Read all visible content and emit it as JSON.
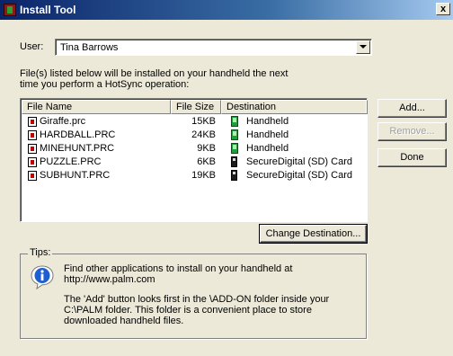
{
  "window": {
    "title": "Install Tool",
    "close_label": "x"
  },
  "user": {
    "label": "User:",
    "selected": "Tina Barrows"
  },
  "description": [
    "File(s) listed below will be installed on your handheld the next",
    "time you perform a HotSync operation:"
  ],
  "table": {
    "columns": [
      "File Name",
      "File Size",
      "Destination"
    ],
    "rows": [
      {
        "name": "Giraffe.prc",
        "size": "15KB",
        "destination": "Handheld",
        "dest_icon": "handheld-icon"
      },
      {
        "name": "HARDBALL.PRC",
        "size": "24KB",
        "destination": "Handheld",
        "dest_icon": "handheld-icon"
      },
      {
        "name": "MINEHUNT.PRC",
        "size": "9KB",
        "destination": "Handheld",
        "dest_icon": "handheld-icon"
      },
      {
        "name": "PUZZLE.PRC",
        "size": "6KB",
        "destination": "SecureDigital (SD) Card",
        "dest_icon": "sd-card-icon"
      },
      {
        "name": "SUBHUNT.PRC",
        "size": "19KB",
        "destination": "SecureDigital (SD) Card",
        "dest_icon": "sd-card-icon"
      }
    ]
  },
  "buttons": {
    "add": "Add...",
    "remove": "Remove...",
    "done": "Done",
    "change_destination": "Change Destination..."
  },
  "tips": {
    "legend": "Tips:",
    "lines": [
      "Find other applications to install on your handheld at",
      "http://www.palm.com",
      "The 'Add' button looks first in the \\ADD-ON folder inside your",
      "C:\\PALM folder. This folder is a convenient place to store",
      "downloaded handheld files."
    ]
  },
  "colors": {
    "window_bg": "#ece9d8",
    "titlebar_start": "#0a246a",
    "handheld_icon": "#1f9e3a"
  }
}
